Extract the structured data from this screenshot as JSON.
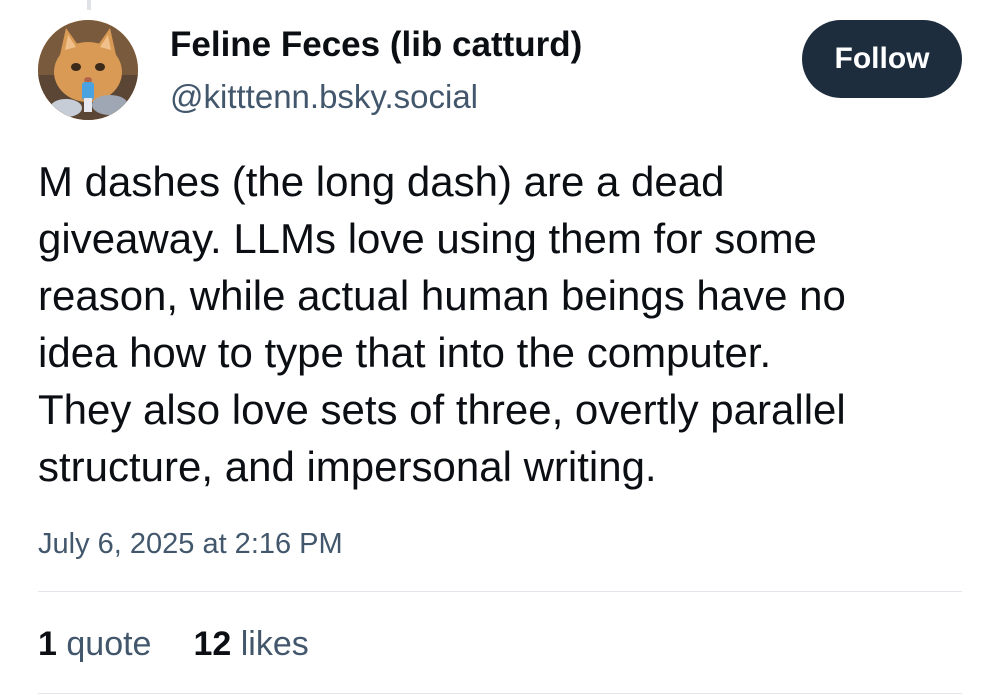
{
  "author": {
    "display_name": "Feline Feces (lib catturd)",
    "handle": "@kitttenn.bsky.social",
    "avatar_icon": "cat-photo-avatar"
  },
  "follow_button": {
    "label": "Follow"
  },
  "post": {
    "text": "M dashes (the long dash) are a dead\ngiveaway. LLMs love using them for some\nreason, while actual human beings have no\nidea how to type that into the computer.\nThey also love sets of three, overtly parallel\nstructure, and impersonal writing.",
    "timestamp": "July 6, 2025 at 2:16 PM"
  },
  "stats": {
    "quotes": {
      "count": "1",
      "label": "quote"
    },
    "likes": {
      "count": "12",
      "label": "likes"
    }
  },
  "colors": {
    "text_primary": "#0b0f14",
    "text_secondary": "#42576c",
    "button_bg": "#1e2d3d",
    "divider": "#e3e7ec"
  }
}
